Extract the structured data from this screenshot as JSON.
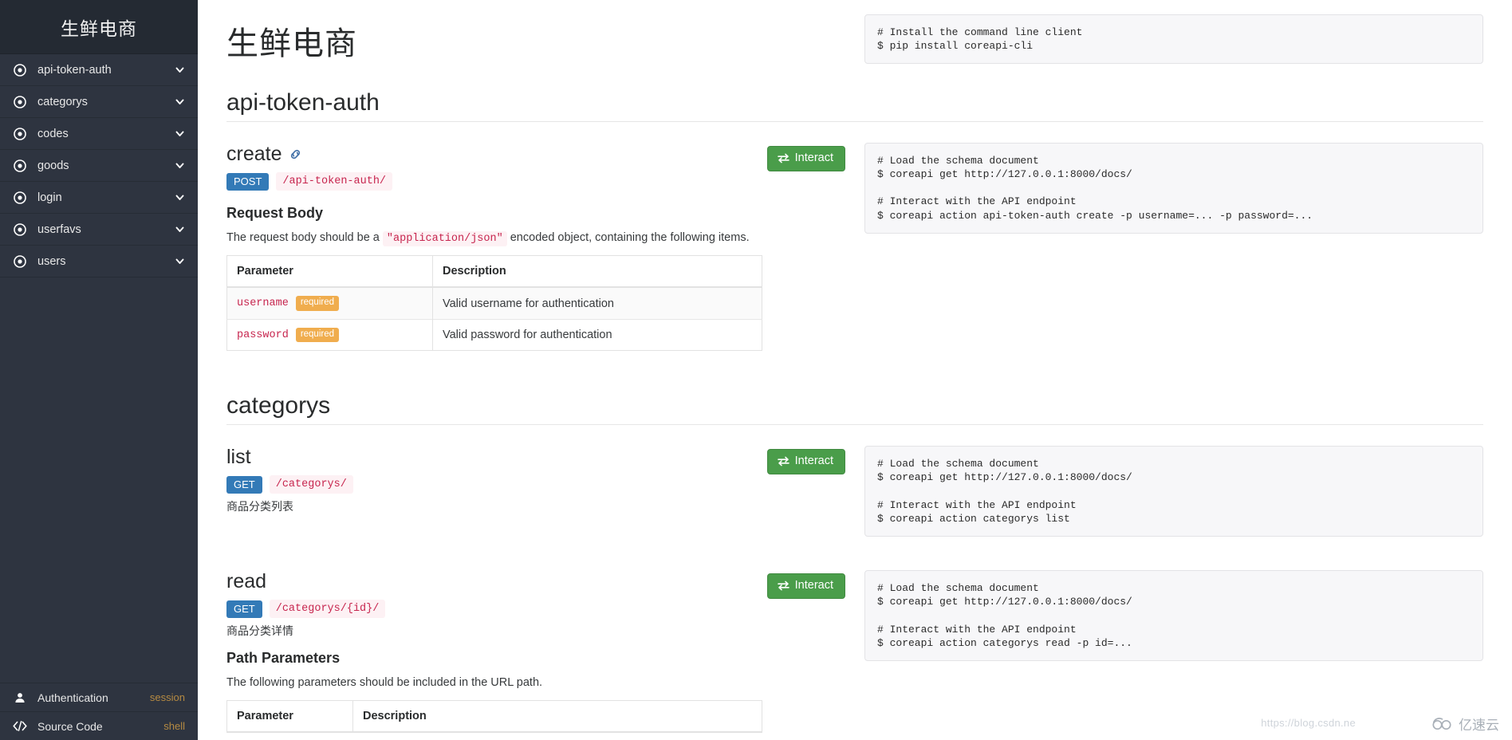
{
  "sidebar": {
    "brand": "生鲜电商",
    "items": [
      {
        "label": "api-token-auth",
        "icon": "target-icon",
        "caret": "chevron-down-icon"
      },
      {
        "label": "categorys",
        "icon": "target-icon",
        "caret": "chevron-down-icon"
      },
      {
        "label": "codes",
        "icon": "target-icon",
        "caret": "chevron-down-icon"
      },
      {
        "label": "goods",
        "icon": "target-icon",
        "caret": "chevron-down-icon"
      },
      {
        "label": "login",
        "icon": "target-icon",
        "caret": "chevron-down-icon"
      },
      {
        "label": "userfavs",
        "icon": "target-icon",
        "caret": "chevron-down-icon"
      },
      {
        "label": "users",
        "icon": "target-icon",
        "caret": "chevron-down-icon"
      }
    ],
    "bottom": [
      {
        "label": "Authentication",
        "meta": "session",
        "icon": "user-icon"
      },
      {
        "label": "Source Code",
        "meta": "shell",
        "icon": "code-icon"
      }
    ]
  },
  "main": {
    "page_title": "生鲜电商",
    "install_code": "# Install the command line client\n$ pip install coreapi-cli"
  },
  "groups": [
    {
      "title": "api-token-auth",
      "links": [
        {
          "name": "create",
          "has_link_icon": true,
          "method": "POST",
          "url": "/api-token-auth/",
          "interact_label": "Interact",
          "description": "",
          "section_head": "Request Body",
          "body_text_pre": "The request body should be a ",
          "body_code": "\"application/json\"",
          "body_text_post": " encoded object, containing the following items.",
          "table": {
            "headers": [
              "Parameter",
              "Description"
            ],
            "rows": [
              {
                "param": "username",
                "required": "required",
                "desc": "Valid username for authentication"
              },
              {
                "param": "password",
                "required": "required",
                "desc": "Valid password for authentication"
              }
            ]
          },
          "code": "# Load the schema document\n$ coreapi get http://127.0.0.1:8000/docs/\n\n# Interact with the API endpoint\n$ coreapi action api-token-auth create -p username=... -p password=..."
        }
      ]
    },
    {
      "title": "categorys",
      "links": [
        {
          "name": "list",
          "has_link_icon": false,
          "method": "GET",
          "url": "/categorys/",
          "interact_label": "Interact",
          "description": "商品分类列表",
          "code": "# Load the schema document\n$ coreapi get http://127.0.0.1:8000/docs/\n\n# Interact with the API endpoint\n$ coreapi action categorys list"
        },
        {
          "name": "read",
          "has_link_icon": false,
          "method": "GET",
          "url": "/categorys/{id}/",
          "interact_label": "Interact",
          "description": "商品分类详情",
          "section_head": "Path Parameters",
          "body_text_pre": "The following parameters should be included in the URL path.",
          "table": {
            "headers": [
              "Parameter",
              "Description"
            ],
            "rows": []
          },
          "code": "# Load the schema document\n$ coreapi get http://127.0.0.1:8000/docs/\n\n# Interact with the API endpoint\n$ coreapi action categorys read -p id=..."
        }
      ]
    }
  ],
  "watermarks": {
    "url": "https://blog.csdn.ne",
    "logo_text": "亿速云"
  },
  "colors": {
    "sidebar_bg": "#2e3440",
    "method_badge": "#337ab7",
    "required_badge": "#f0ad4e",
    "interact_green": "#4a9d4a",
    "code_pink": "#c7254e"
  }
}
